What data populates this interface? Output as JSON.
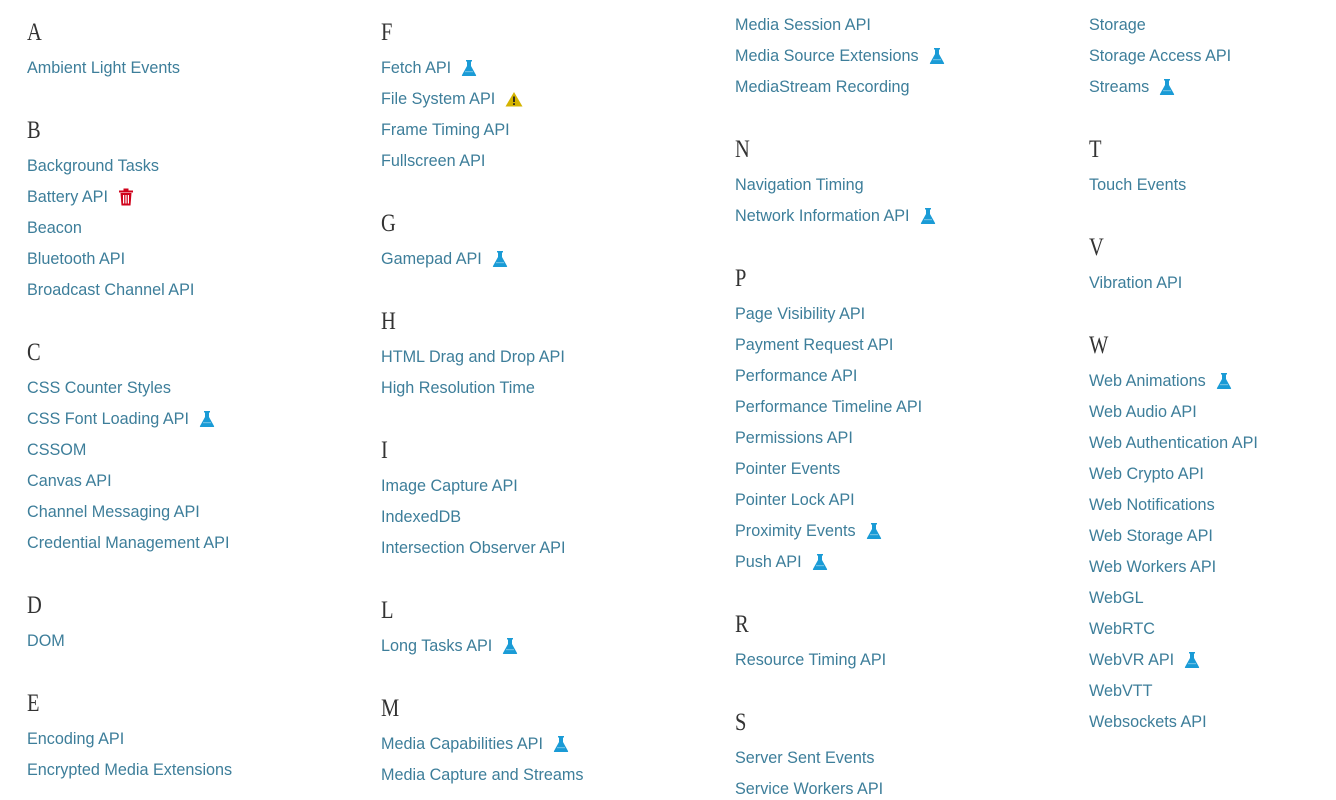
{
  "columns": [
    {
      "groups": [
        {
          "letter": "A",
          "items": [
            {
              "label": "Ambient Light Events",
              "badge": ""
            }
          ]
        },
        {
          "letter": "B",
          "items": [
            {
              "label": "Background Tasks",
              "badge": ""
            },
            {
              "label": "Battery API",
              "badge": "trash"
            },
            {
              "label": "Beacon",
              "badge": ""
            },
            {
              "label": "Bluetooth API",
              "badge": ""
            },
            {
              "label": "Broadcast Channel API",
              "badge": ""
            }
          ]
        },
        {
          "letter": "C",
          "items": [
            {
              "label": "CSS Counter Styles",
              "badge": ""
            },
            {
              "label": "CSS Font Loading API",
              "badge": "flask"
            },
            {
              "label": "CSSOM",
              "badge": ""
            },
            {
              "label": "Canvas API",
              "badge": ""
            },
            {
              "label": "Channel Messaging API",
              "badge": ""
            },
            {
              "label": "Credential Management API",
              "badge": ""
            }
          ]
        },
        {
          "letter": "D",
          "items": [
            {
              "label": "DOM",
              "badge": ""
            }
          ]
        },
        {
          "letter": "E",
          "items": [
            {
              "label": "Encoding API",
              "badge": ""
            },
            {
              "label": "Encrypted Media Extensions",
              "badge": ""
            }
          ]
        }
      ]
    },
    {
      "groups": [
        {
          "letter": "F",
          "items": [
            {
              "label": "Fetch API",
              "badge": "flask"
            },
            {
              "label": "File System API",
              "badge": "warning"
            },
            {
              "label": "Frame Timing API",
              "badge": ""
            },
            {
              "label": "Fullscreen API",
              "badge": ""
            }
          ]
        },
        {
          "letter": "G",
          "items": [
            {
              "label": "Gamepad API",
              "badge": "flask"
            }
          ]
        },
        {
          "letter": "H",
          "items": [
            {
              "label": "HTML Drag and Drop API",
              "badge": ""
            },
            {
              "label": "High Resolution Time",
              "badge": ""
            }
          ]
        },
        {
          "letter": "I",
          "items": [
            {
              "label": "Image Capture API",
              "badge": ""
            },
            {
              "label": "IndexedDB",
              "badge": ""
            },
            {
              "label": "Intersection Observer API",
              "badge": ""
            }
          ]
        },
        {
          "letter": "L",
          "items": [
            {
              "label": "Long Tasks API",
              "badge": "flask"
            }
          ]
        },
        {
          "letter": "M",
          "items": [
            {
              "label": "Media Capabilities API",
              "badge": "flask"
            },
            {
              "label": "Media Capture and Streams",
              "badge": ""
            }
          ]
        }
      ]
    },
    {
      "groups": [
        {
          "letter": "",
          "items": [
            {
              "label": "Media Session API",
              "badge": ""
            },
            {
              "label": "Media Source Extensions",
              "badge": "flask"
            },
            {
              "label": "MediaStream Recording",
              "badge": ""
            }
          ]
        },
        {
          "letter": "N",
          "items": [
            {
              "label": "Navigation Timing",
              "badge": ""
            },
            {
              "label": "Network Information API",
              "badge": "flask"
            }
          ]
        },
        {
          "letter": "P",
          "items": [
            {
              "label": "Page Visibility API",
              "badge": ""
            },
            {
              "label": "Payment Request API",
              "badge": ""
            },
            {
              "label": "Performance API",
              "badge": ""
            },
            {
              "label": "Performance Timeline API",
              "badge": ""
            },
            {
              "label": "Permissions API",
              "badge": ""
            },
            {
              "label": "Pointer Events",
              "badge": ""
            },
            {
              "label": "Pointer Lock API",
              "badge": ""
            },
            {
              "label": "Proximity Events",
              "badge": "flask"
            },
            {
              "label": "Push API",
              "badge": "flask"
            }
          ]
        },
        {
          "letter": "R",
          "items": [
            {
              "label": "Resource Timing API",
              "badge": ""
            }
          ]
        },
        {
          "letter": "S",
          "items": [
            {
              "label": "Server Sent Events",
              "badge": ""
            },
            {
              "label": "Service Workers API",
              "badge": ""
            }
          ]
        }
      ]
    },
    {
      "groups": [
        {
          "letter": "",
          "items": [
            {
              "label": "Storage",
              "badge": ""
            },
            {
              "label": "Storage Access API",
              "badge": ""
            },
            {
              "label": "Streams",
              "badge": "flask"
            }
          ]
        },
        {
          "letter": "T",
          "items": [
            {
              "label": "Touch Events",
              "badge": ""
            }
          ]
        },
        {
          "letter": "V",
          "items": [
            {
              "label": "Vibration API",
              "badge": ""
            }
          ]
        },
        {
          "letter": "W",
          "items": [
            {
              "label": "Web Animations",
              "badge": "flask"
            },
            {
              "label": "Web Audio API",
              "badge": ""
            },
            {
              "label": "Web Authentication API",
              "badge": ""
            },
            {
              "label": "Web Crypto API",
              "badge": ""
            },
            {
              "label": "Web Notifications",
              "badge": ""
            },
            {
              "label": "Web Storage API",
              "badge": ""
            },
            {
              "label": "Web Workers API",
              "badge": ""
            },
            {
              "label": "WebGL",
              "badge": ""
            },
            {
              "label": "WebRTC",
              "badge": ""
            },
            {
              "label": "WebVR API",
              "badge": "flask"
            },
            {
              "label": "WebVTT",
              "badge": ""
            },
            {
              "label": "Websockets API",
              "badge": ""
            }
          ]
        }
      ]
    }
  ],
  "colors": {
    "link": "#3d7e9a",
    "letter": "#333333",
    "flask": "#1a9bd6",
    "warning": "#d4b300",
    "trash": "#d0021b"
  },
  "icons": {
    "flask": "flask-icon",
    "warning": "warning-icon",
    "trash": "trash-icon"
  }
}
